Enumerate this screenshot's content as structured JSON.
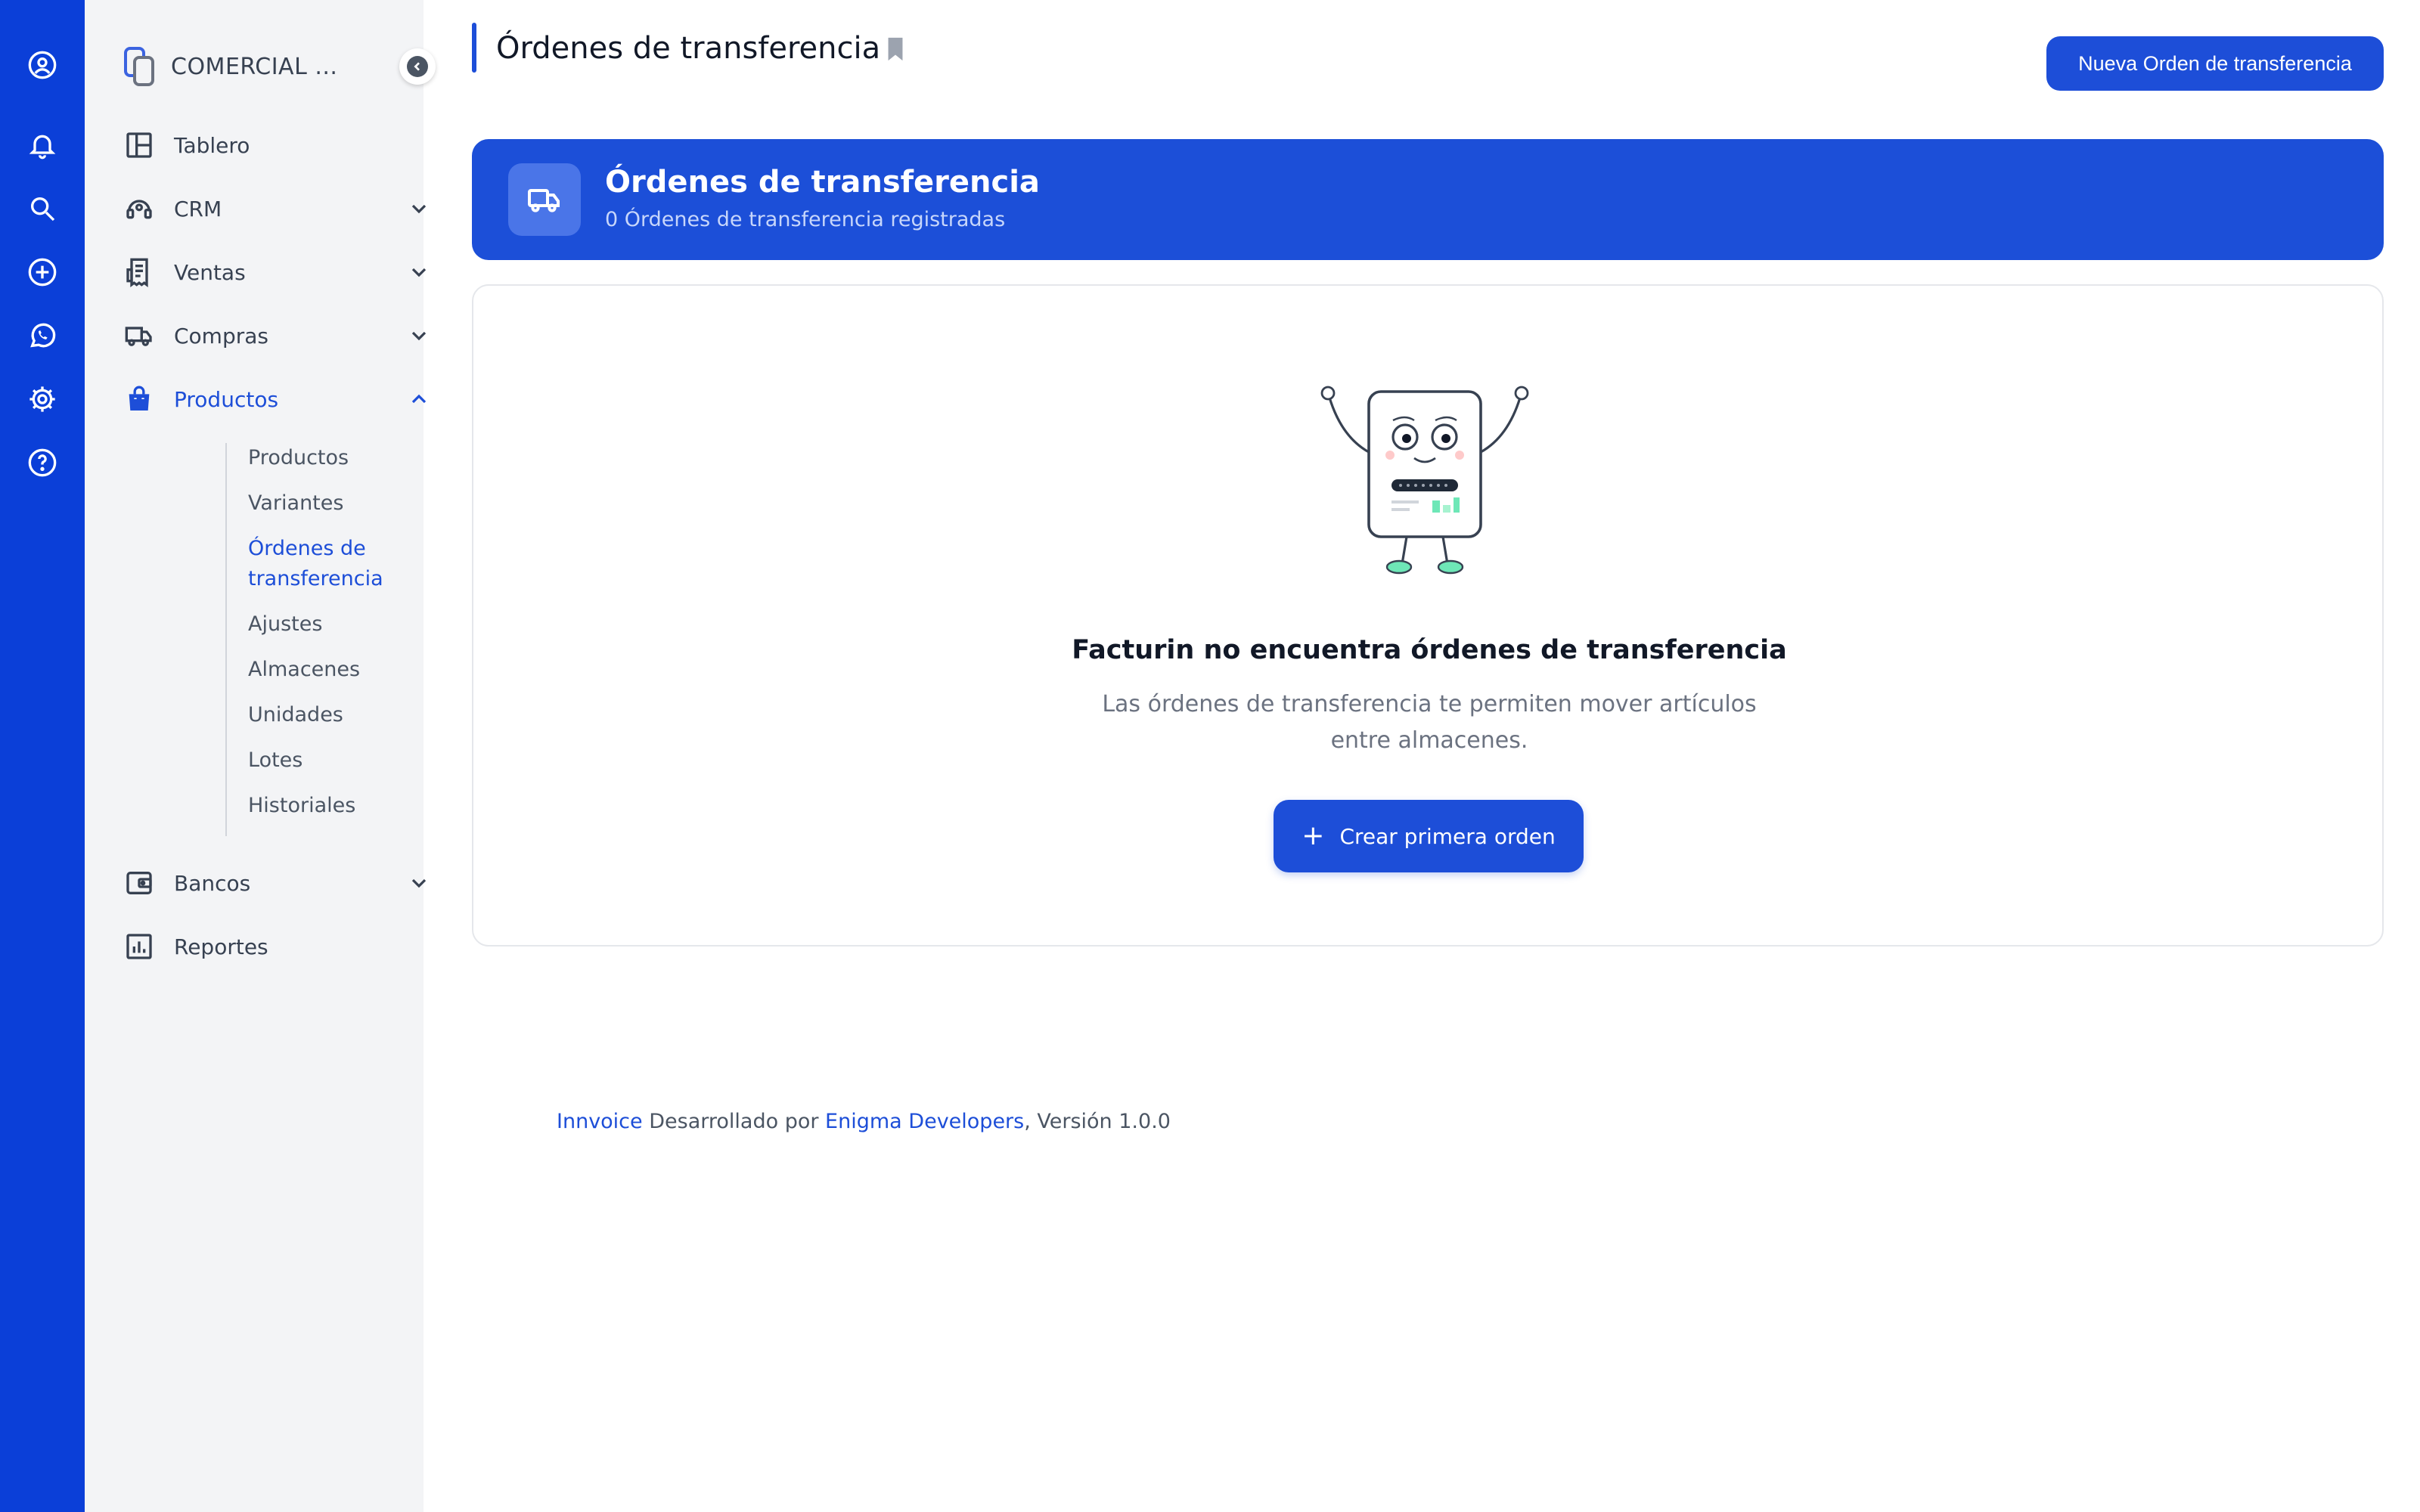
{
  "rail": {
    "icons": [
      "user-circle-icon",
      "bell-icon",
      "search-icon",
      "plus-circle-icon",
      "whatsapp-icon",
      "gear-icon",
      "help-icon"
    ]
  },
  "sidebar": {
    "company_name": "COMERCIAL ...",
    "nav": [
      {
        "label": "Tablero",
        "icon": "dashboard-icon"
      },
      {
        "label": "CRM",
        "icon": "headset-icon"
      },
      {
        "label": "Ventas",
        "icon": "receipt-icon"
      },
      {
        "label": "Compras",
        "icon": "truck-icon"
      },
      {
        "label": "Productos",
        "icon": "shopping-bag-icon"
      },
      {
        "label": "Bancos",
        "icon": "wallet-icon"
      },
      {
        "label": "Reportes",
        "icon": "chart-icon"
      }
    ],
    "sub": [
      {
        "label": "Productos"
      },
      {
        "label": "Variantes"
      },
      {
        "label": "Órdenes de transferencia"
      },
      {
        "label": "Ajustes"
      },
      {
        "label": "Almacenes"
      },
      {
        "label": "Unidades"
      },
      {
        "label": "Lotes"
      },
      {
        "label": "Historiales"
      }
    ]
  },
  "header": {
    "title": "Órdenes de transferencia",
    "new_button": "Nueva Orden de transferencia"
  },
  "hero": {
    "title": "Órdenes de transferencia",
    "subtitle": "0 Órdenes de transferencia registradas"
  },
  "empty": {
    "title": "Facturin no encuentra órdenes de transferencia",
    "description": "Las órdenes de transferencia te permiten mover artículos entre almacenes.",
    "button": "Crear primera orden"
  },
  "footer": {
    "brand": "Innvoice",
    "middle": " Desarrollado por ",
    "developer": "Enigma Developers",
    "version": ", Versión 1.0.0"
  },
  "colors": {
    "primary": "#1d4ed8",
    "rail": "#0b3fd8",
    "sidebar": "#f3f4f6"
  }
}
